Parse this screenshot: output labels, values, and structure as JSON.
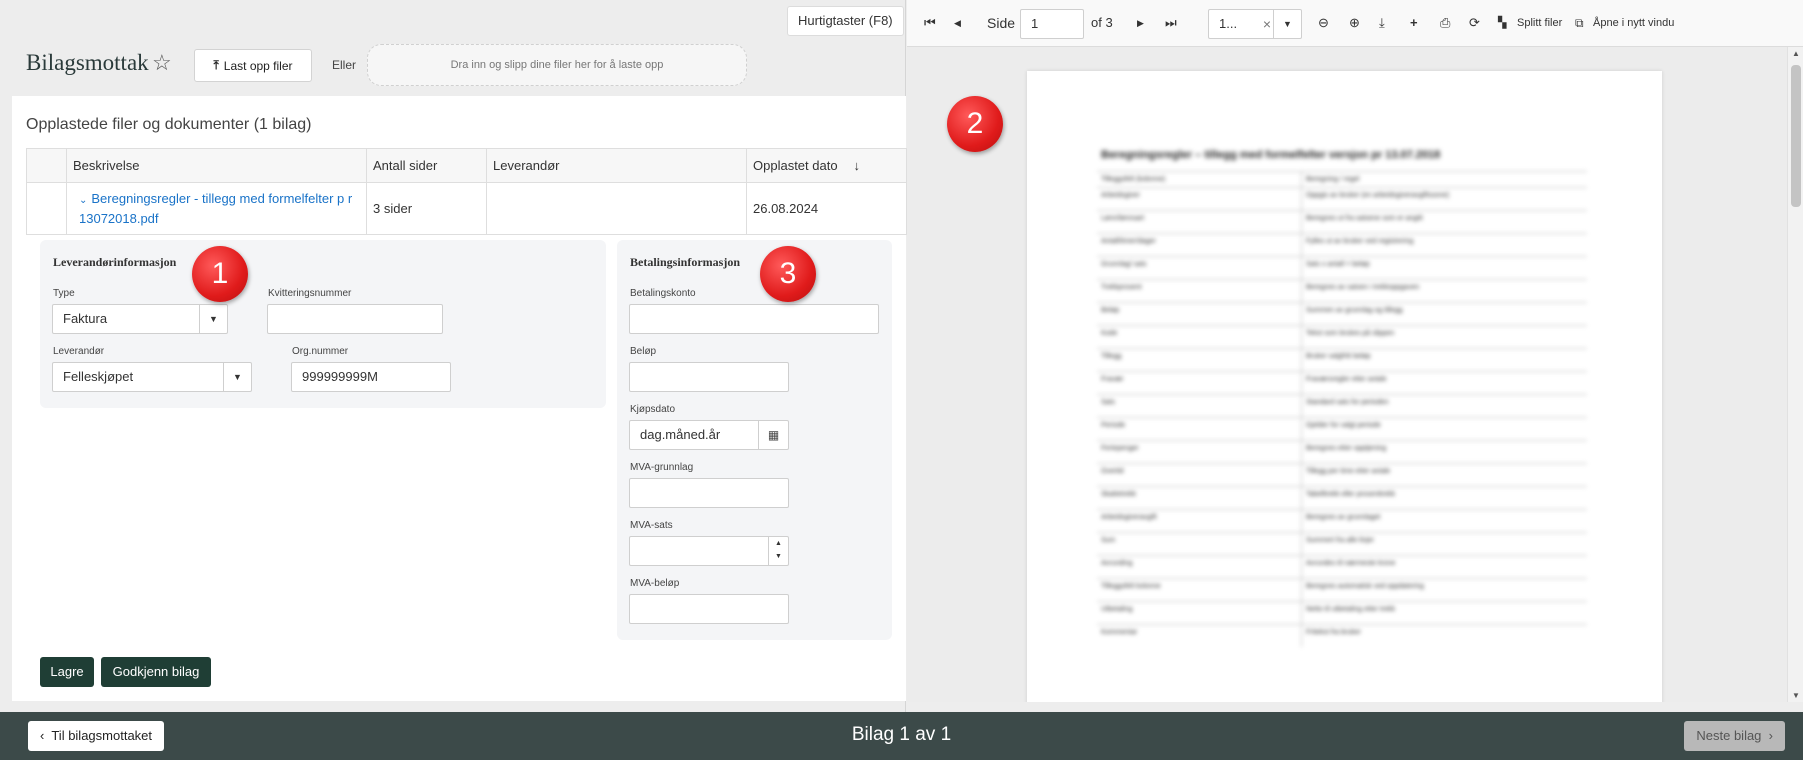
{
  "header": {
    "hotkeys": "Hurtigtaster (F8)",
    "title": "Bilagsmottak",
    "upload_label": "Last opp filer",
    "or_label": "Eller",
    "dropzone_text": "Dra inn og slipp dine filer her for å laste opp"
  },
  "uploads": {
    "title": "Opplastede filer og dokumenter (1 bilag)",
    "columns": [
      "Beskrivelse",
      "Antall sider",
      "Leverandør",
      "Opplastet dato"
    ],
    "rows": [
      {
        "description": "Beregningsregler - tillegg med formelfelter p r 13072018.pdf",
        "pages": "3 sider",
        "supplier": "",
        "date": "26.08.2024"
      }
    ]
  },
  "supplier_info": {
    "title": "Leverandørinformasjon",
    "type_label": "Type",
    "type_value": "Faktura",
    "receipt_label": "Kvitteringsnummer",
    "receipt_value": "",
    "supplier_label": "Leverandør",
    "supplier_value": "Felleskjøpet",
    "org_label": "Org.nummer",
    "org_value": "999999999M"
  },
  "payment_info": {
    "title": "Betalingsinformasjon",
    "account_label": "Betalingskonto",
    "amount_label": "Beløp",
    "purchase_date_label": "Kjøpsdato",
    "purchase_date_placeholder": "dag.måned.år",
    "vat_base_label": "MVA-grunnlag",
    "vat_rate_label": "MVA-sats",
    "vat_amount_label": "MVA-beløp"
  },
  "actions": {
    "save": "Lagre",
    "approve": "Godkjenn bilag"
  },
  "badges": [
    "1",
    "2",
    "3"
  ],
  "viewer": {
    "page_label": "Side",
    "page_value": "1",
    "of_label": "of 3",
    "zoom_value": "1...",
    "split_label": "Splitt filer",
    "open_new_label": "Åpne i nytt vindu",
    "doc_heading": "Beregningsregler – tillegg med formelfelter versjon pr 13.07.2018",
    "doc_header_row": [
      "Tilleggsfelt (kolonne)",
      "Beregning / regel"
    ],
    "doc_rows": [
      [
        "Arbeidsgiver",
        "Oppgis av bruker (en arbeidsgiveravgiftssone)"
      ],
      [
        "Lønn/lønnsart",
        "Beregnes ut fra satsene som er angitt"
      ],
      [
        "Antall/timer/dager",
        "Fylles ut av bruker ved registrering"
      ],
      [
        "Grunnlag/ sats",
        "Sats x antall = beløp"
      ],
      [
        "Trekkprosent",
        "Beregnes av satsen i trekkoppgaven"
      ],
      [
        "Beløp",
        "Summen av grunnlag og tillegg"
      ],
      [
        "Kode",
        "Tekst som brukes på slippen"
      ],
      [
        "Tillegg",
        "Bruker valgfritt beløp"
      ],
      [
        "Fravær",
        "Fraværsregler etter avtale"
      ],
      [
        "Sats",
        "Standard sats for perioden"
      ],
      [
        "Periode",
        "Gjelder for valgt periode"
      ],
      [
        "Feriepenger",
        "Beregnes etter opptjening"
      ],
      [
        "Overtid",
        "Tillegg per time etter avtale"
      ],
      [
        "Skattetrekk",
        "Tabelltrekk eller prosenttrekk"
      ],
      [
        "Arbeidsgiveravgift",
        "Beregnes av grunnlaget"
      ],
      [
        "Sum",
        "Summert fra alle linjer"
      ],
      [
        "Avrunding",
        "Avrundes til nærmeste krone"
      ],
      [
        "Tilleggsfelt kolonne",
        "Beregnes automatisk ved oppdatering"
      ],
      [
        "Utbetaling",
        "Netto til utbetaling etter trekk"
      ],
      [
        "Kommentar",
        "Fritekst fra bruker"
      ]
    ]
  },
  "footer": {
    "back_label": "Til bilagsmottaket",
    "title": "Bilag 1 av 1",
    "next_label": "Neste bilag"
  }
}
